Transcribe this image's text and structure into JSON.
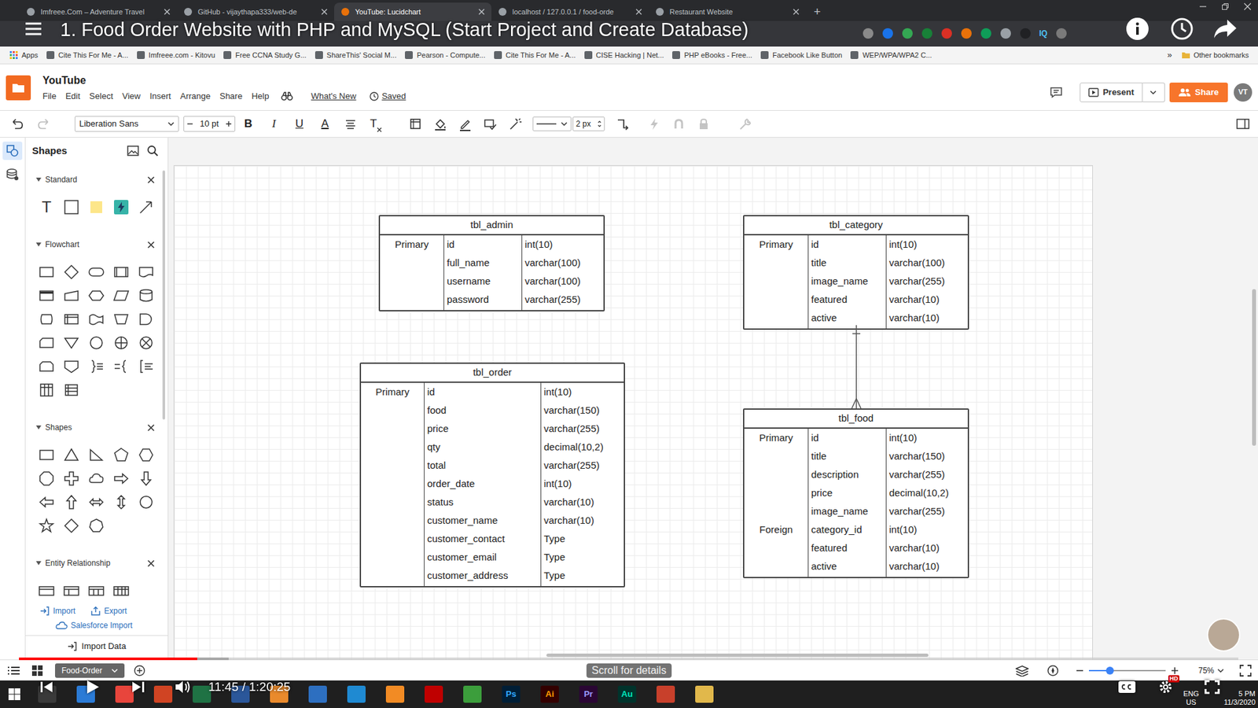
{
  "browser": {
    "tabs": [
      {
        "label": "Imfreee.Com – Adventure Travel",
        "selected": false
      },
      {
        "label": "GitHub - vijaythapa333/web-de",
        "selected": false
      },
      {
        "label": "YouTube: Lucidchart",
        "selected": true
      },
      {
        "label": "localhost / 127.0.0.1 / food-orde",
        "selected": false
      },
      {
        "label": "Restaurant Website",
        "selected": false
      }
    ],
    "new_tab": "+",
    "extensions": [
      "IQ"
    ],
    "bookmarks": [
      "Apps",
      "Cite This For Me - A...",
      "Imfreee.com - Kitovu",
      "Free CCNA Study G...",
      "ShareThis' Social M...",
      "Pearson - Compute...",
      "Cite This For Me - A...",
      "CISE Hacking | Net...",
      "PHP eBooks - Free...",
      "Facebook Like Button",
      "WEP/WPA/WPA2 C..."
    ],
    "bookmarks_more": "»",
    "other_bookmarks": "Other bookmarks"
  },
  "video": {
    "title": "1. Food Order Website with PHP and MySQL (Start Project and Create Database)",
    "time": "11:45 / 1:20:25",
    "hint": "Scroll for details",
    "progress": {
      "level": 0.146,
      "buffered": 0.172
    },
    "quality_badge": "HD"
  },
  "app": {
    "doc_title": "YouTube",
    "menus": [
      "File",
      "Edit",
      "Select",
      "View",
      "Insert",
      "Arrange",
      "Share",
      "Help"
    ],
    "whats_new": "What's New",
    "saved": "Saved",
    "present": "Present",
    "share": "Share",
    "avatar": "VT"
  },
  "toolbar": {
    "font": "Liberation Sans",
    "font_size": "10 pt",
    "line_width": "2 px",
    "text_format": [
      {
        "label": "B",
        "kind": "bold"
      },
      {
        "label": "I",
        "kind": "italic"
      },
      {
        "label": "U",
        "kind": "underline"
      },
      {
        "label": "A",
        "kind": "color"
      },
      {
        "label": "T",
        "kind": "clear"
      }
    ]
  },
  "shapes_panel": {
    "title": "Shapes",
    "sections": [
      {
        "label": "Standard",
        "expanded": true
      },
      {
        "label": "Flowchart",
        "expanded": true
      },
      {
        "label": "Shapes",
        "expanded": true
      },
      {
        "label": "Entity Relationship",
        "expanded": true
      }
    ],
    "text_tool": "T",
    "import": "Import",
    "export": "Export",
    "salesforce_import": "Salesforce Import",
    "import_data": "Import Data"
  },
  "diagram": {
    "tables": [
      {
        "title": "tbl_admin",
        "rows": [
          {
            "key": "Primary",
            "field": "id",
            "type": "int(10)"
          },
          {
            "field": "full_name",
            "type": "varchar(100)"
          },
          {
            "field": "username",
            "type": "varchar(100)"
          },
          {
            "field": "password",
            "type": "varchar(255)"
          }
        ]
      },
      {
        "title": "tbl_category",
        "rows": [
          {
            "key": "Primary",
            "field": "id",
            "type": "int(10)"
          },
          {
            "field": "title",
            "type": "varchar(100)"
          },
          {
            "field": "image_name",
            "type": "varchar(255)"
          },
          {
            "field": "featured",
            "type": "varchar(10)"
          },
          {
            "field": "active",
            "type": "varchar(10)"
          }
        ]
      },
      {
        "title": "tbl_order",
        "rows": [
          {
            "key": "Primary",
            "field": "id",
            "type": "int(10)"
          },
          {
            "field": "food",
            "type": "varchar(150)"
          },
          {
            "field": "price",
            "type": "varchar(255)"
          },
          {
            "field": "qty",
            "type": "decimal(10,2)"
          },
          {
            "field": "total",
            "type": "varchar(255)"
          },
          {
            "field": "order_date",
            "type": "int(10)"
          },
          {
            "field": "status",
            "type": "varchar(10)"
          },
          {
            "field": "customer_name",
            "type": "varchar(10)"
          },
          {
            "field": "customer_contact",
            "type": "Type"
          },
          {
            "field": "customer_email",
            "type": "Type"
          },
          {
            "field": "customer_address",
            "type": "Type"
          }
        ]
      },
      {
        "title": "tbl_food",
        "rows": [
          {
            "key": "Primary",
            "field": "id",
            "type": "int(10)"
          },
          {
            "field": "title",
            "type": "varchar(150)"
          },
          {
            "field": "description",
            "type": "varchar(255)"
          },
          {
            "field": "price",
            "type": "decimal(10,2)"
          },
          {
            "field": "image_name",
            "type": "varchar(255)"
          },
          {
            "key": "Foreign",
            "field": "category_id",
            "type": "int(10)"
          },
          {
            "field": "featured",
            "type": "varchar(10)"
          },
          {
            "field": "active",
            "type": "varchar(10)"
          }
        ]
      }
    ]
  },
  "status_bar": {
    "page_tab": "Food-Order",
    "zoom": "75%",
    "zoom_slider": {
      "level": 0.27
    }
  },
  "taskbar": {
    "apps": [
      {
        "color": "#3a3a3a"
      },
      {
        "color": "#2b7bd6"
      },
      {
        "color": "#e8453c"
      },
      {
        "color": "#d04423"
      },
      {
        "color": "#1f7244"
      },
      {
        "color": "#2b579a"
      },
      {
        "color": "#e98a2c"
      },
      {
        "color": "#2d6fc0"
      },
      {
        "color": "#1f8ad2"
      },
      {
        "color": "#f28b24"
      },
      {
        "color": "#bf0000"
      },
      {
        "color": "#3c9e3c"
      },
      {
        "label": "Ps",
        "color": "#001e36",
        "accent": "#31a8ff"
      },
      {
        "label": "Ai",
        "color": "#330000",
        "accent": "#ff9a00"
      },
      {
        "label": "Pr",
        "color": "#2a0634",
        "accent": "#9999ff"
      },
      {
        "label": "Au",
        "color": "#00332b",
        "accent": "#00e4bb"
      },
      {
        "color": "#c8402b"
      },
      {
        "color": "#e1b84b"
      }
    ],
    "language": "ENG",
    "region": "US",
    "time": "5 PM",
    "date": "11/3/2020"
  }
}
